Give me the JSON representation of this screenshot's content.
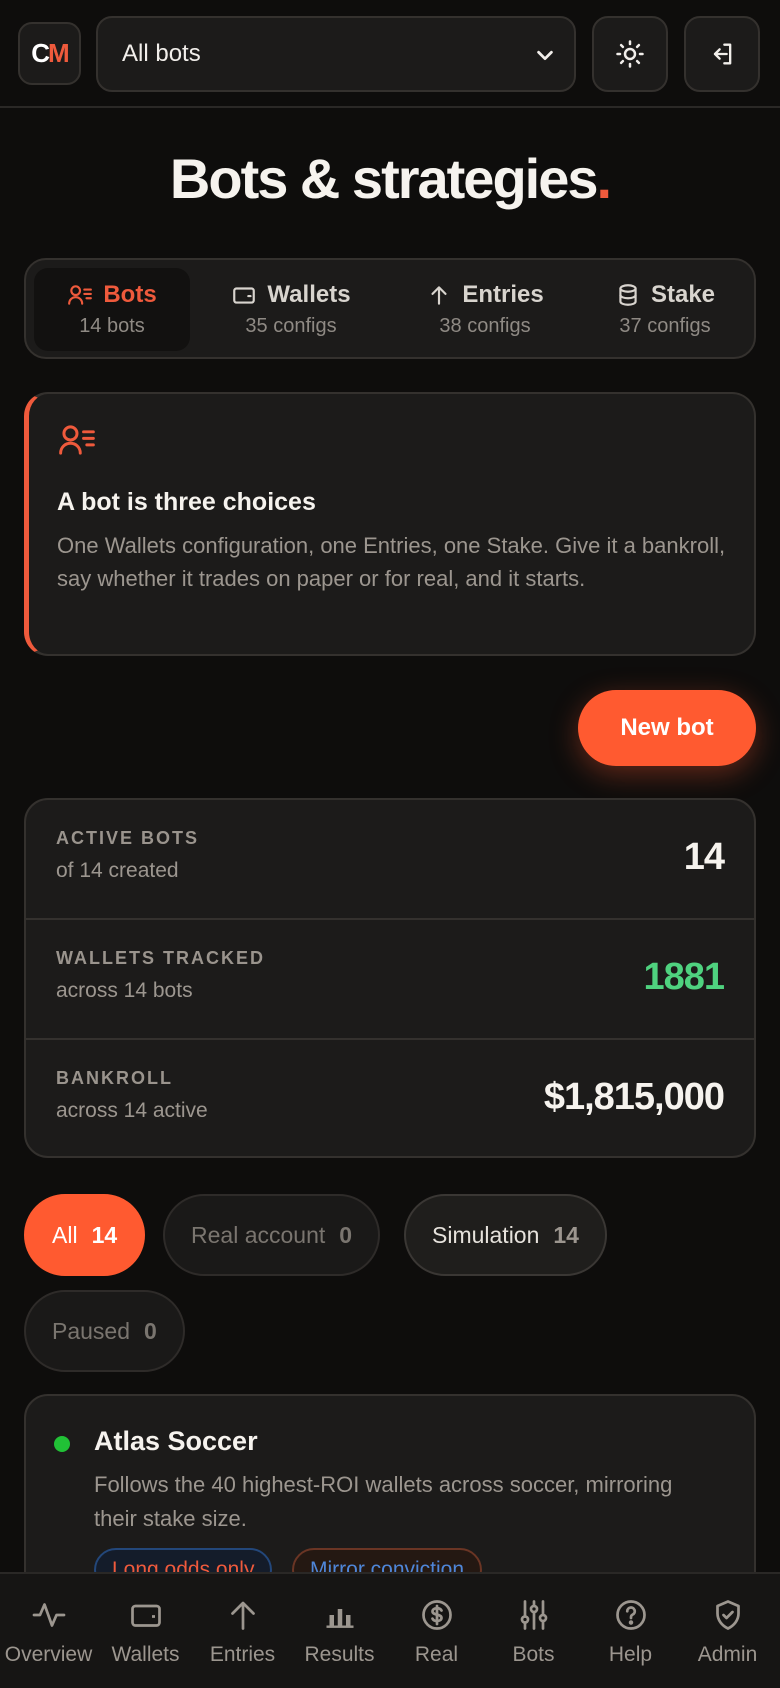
{
  "topbar": {
    "logo": {
      "c": "C",
      "m": "M"
    },
    "bot_select": "All bots",
    "icons": {
      "theme": "sun-icon",
      "logout": "logout-icon",
      "chevron": "chevron-down-icon"
    }
  },
  "page": {
    "title": "Bots & strategies",
    "title_dot": "."
  },
  "tabs": [
    {
      "label": "Bots",
      "sub": "14 bots",
      "icon": "bots-icon",
      "active": true
    },
    {
      "label": "Wallets",
      "sub": "35 configs",
      "icon": "wallet-icon"
    },
    {
      "label": "Entries",
      "sub": "38 configs",
      "icon": "arrow-up-icon"
    },
    {
      "label": "Stake",
      "sub": "37 configs",
      "icon": "database-icon"
    }
  ],
  "info": {
    "title": "A bot is three choices",
    "text": "One Wallets configuration, one Entries, one Stake. Give it a bankroll, say whether it trades on paper or for real, and it starts."
  },
  "new_bot_label": "New bot",
  "stats": [
    {
      "label": "ACTIVE BOTS",
      "desc": "of 14 created",
      "value": "14"
    },
    {
      "label": "WALLETS TRACKED",
      "desc": "across 14 bots",
      "value": "1881"
    },
    {
      "label": "BANKROLL",
      "desc": "across 14 active",
      "value": "$1,815,000"
    }
  ],
  "filters": [
    {
      "label": "All",
      "count": "14"
    },
    {
      "label": "Real account",
      "count": "0"
    },
    {
      "label": "Simulation",
      "count": "14"
    },
    {
      "label": "Paused",
      "count": "0"
    }
  ],
  "bot_card": {
    "name": "Atlas Soccer",
    "description": "Follows the 40 highest-ROI wallets across soccer, mirroring their stake size.",
    "tags": [
      "Long odds only",
      "Mirror conviction"
    ]
  },
  "nav": [
    {
      "label": "Overview",
      "icon": "activity-icon"
    },
    {
      "label": "Wallets",
      "icon": "wallet-icon"
    },
    {
      "label": "Entries",
      "icon": "arrow-up-icon"
    },
    {
      "label": "Results",
      "icon": "bar-chart-icon"
    },
    {
      "label": "Real",
      "icon": "dollar-icon"
    },
    {
      "label": "Bots",
      "icon": "sliders-icon"
    },
    {
      "label": "Help",
      "icon": "help-icon"
    },
    {
      "label": "Admin",
      "icon": "shield-icon"
    }
  ],
  "colors": {
    "accent": "#ff5a30",
    "positive": "#4fd27f",
    "background": "#0e0d0c",
    "card": "#1c1b1a"
  }
}
